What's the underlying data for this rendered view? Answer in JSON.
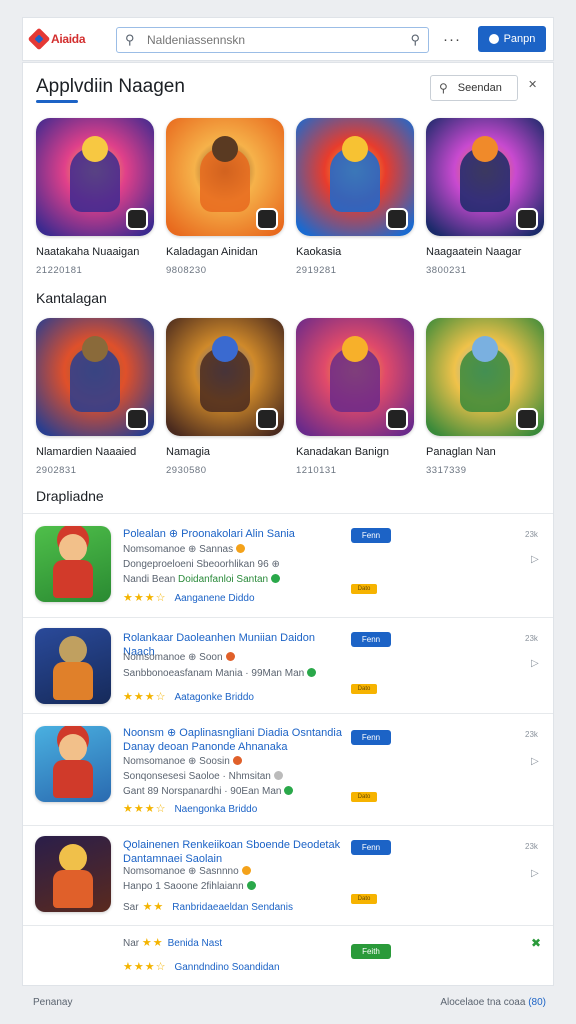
{
  "app": {
    "logo_text": "Aiaida"
  },
  "search": {
    "placeholder": "Naldeniassennskn"
  },
  "header": {
    "more_label": "···",
    "signin_label": "Panpn"
  },
  "main": {
    "title": "Applvdiin Naagen",
    "sort_label": "Seendan",
    "featured": [
      {
        "name": "Naatakaha Nuaaigan",
        "meta": "21220181",
        "art": "space-hero",
        "colors": [
          "#3c2a8f",
          "#e0408a",
          "#f7c842"
        ]
      },
      {
        "name": "Kaladagan Ainidan",
        "meta": "9808230",
        "art": "warrior-portrait",
        "colors": [
          "#e86a1e",
          "#f6b24a",
          "#5a3a22"
        ]
      },
      {
        "name": "Kaokasia",
        "meta": "2919281",
        "art": "star-orb",
        "colors": [
          "#1a6ad0",
          "#e83c2c",
          "#f7c233"
        ]
      },
      {
        "name": "Naagaatein Naagar",
        "meta": "3800231",
        "art": "blaster-hero",
        "colors": [
          "#1b2a6a",
          "#c94ad0",
          "#f08a2a"
        ]
      }
    ],
    "section2_title": "Kantalagan",
    "popular": [
      {
        "name": "Nlamardien Naaaied",
        "meta": "2902831",
        "art": "robot-warrior",
        "colors": [
          "#2a3e8f",
          "#e0502a",
          "#8a6a3a"
        ]
      },
      {
        "name": "Namagia",
        "meta": "2930580",
        "art": "ruker-squad",
        "colors": [
          "#4a2a1e",
          "#d08a2a",
          "#3a6ad0"
        ]
      },
      {
        "name": "Kanadakan Banign",
        "meta": "1210131",
        "art": "soldier-blast",
        "colors": [
          "#6a2a8a",
          "#e04a6a",
          "#f7b02a"
        ]
      },
      {
        "name": "Panaglan Nan",
        "meta": "3317339",
        "art": "village-scene",
        "colors": [
          "#3a8a3a",
          "#f0c24a",
          "#7ab0e0"
        ]
      }
    ],
    "section3_title": "Drapliadne",
    "list": [
      {
        "title": "Polealan ⊕ Proonakolari Alin Sania",
        "line1": "Nomsomanoe ⊕ Sannas",
        "line2": "Dongeproeloeni Sbeoorhlikan 96 ⊕",
        "line3_a": "Nandi Bean",
        "line3_b": "Doidanfanloi Santan",
        "stars": "★★★☆",
        "rating_text": "Aanganene Diddo",
        "get": "Fenn",
        "tag": "Dato",
        "size": "23k",
        "thumb_colors": [
          "#3aa84a",
          "#d23a2a",
          "#f2c08a"
        ]
      },
      {
        "title": "Rolankaar Daoleanhen Muniian Daidon Naach",
        "line1": "Nomsomanoe ⊕ Soon",
        "line2": "Sanbbonoeasfanam Mania · 99Man Man",
        "line3_a": "",
        "line3_b": "",
        "stars": "★★★☆",
        "rating_text": "Aatagonke Briddo",
        "get": "Fenn",
        "tag": "Dato",
        "size": "23k",
        "thumb_colors": [
          "#1f3a7a",
          "#e0802a",
          "#c0a060"
        ]
      },
      {
        "title": "Noonsm ⊕ Oaplinasngliani Diadia Osntandia Danay deoan Panonde Ahnanaka",
        "line1": "Nomsomanoe ⊕ Soosin",
        "line2": "Sonqonsesesi Saoloe · Nhmsitan",
        "line3_a": "Gant 89",
        "line3_b": "Norspanardhi · 90Ean Man",
        "stars": "★★★☆",
        "rating_text": "Naengonka Briddo",
        "get": "Fenn",
        "tag": "Dato",
        "size": "23k",
        "thumb_colors": [
          "#3a9ad0",
          "#d03a2a",
          "#f0b02a"
        ]
      },
      {
        "title": "Qolainenen Renkeiikoan Sboende Deodetak Dantamnaei Saolain",
        "line1": "Nomsomanoe ⊕ Sasnnno",
        "line2": "Hanpo 1 Saoone 2fihlaiann",
        "line3_a": "",
        "line3_b": "",
        "stars": "★★",
        "rating_text": "Ranbridaeaeldan Sendanis",
        "prefix": "Sar",
        "get": "Fenn",
        "tag": "Dato",
        "size": "23k",
        "thumb_colors": [
          "#2a1e4a",
          "#e0602a",
          "#f0c04a"
        ]
      }
    ],
    "last_row": {
      "line1_prefix": "Nar",
      "line1_stars": "★★",
      "line1_text": "Benida Nast",
      "line2_stars": "★★★☆",
      "line2_text": "Ganndndino Soandidan",
      "get": "Feith"
    }
  },
  "footer": {
    "left": "Penanay",
    "right_prefix": "Alocelaoe tna coaa",
    "right_link": "(80)"
  }
}
